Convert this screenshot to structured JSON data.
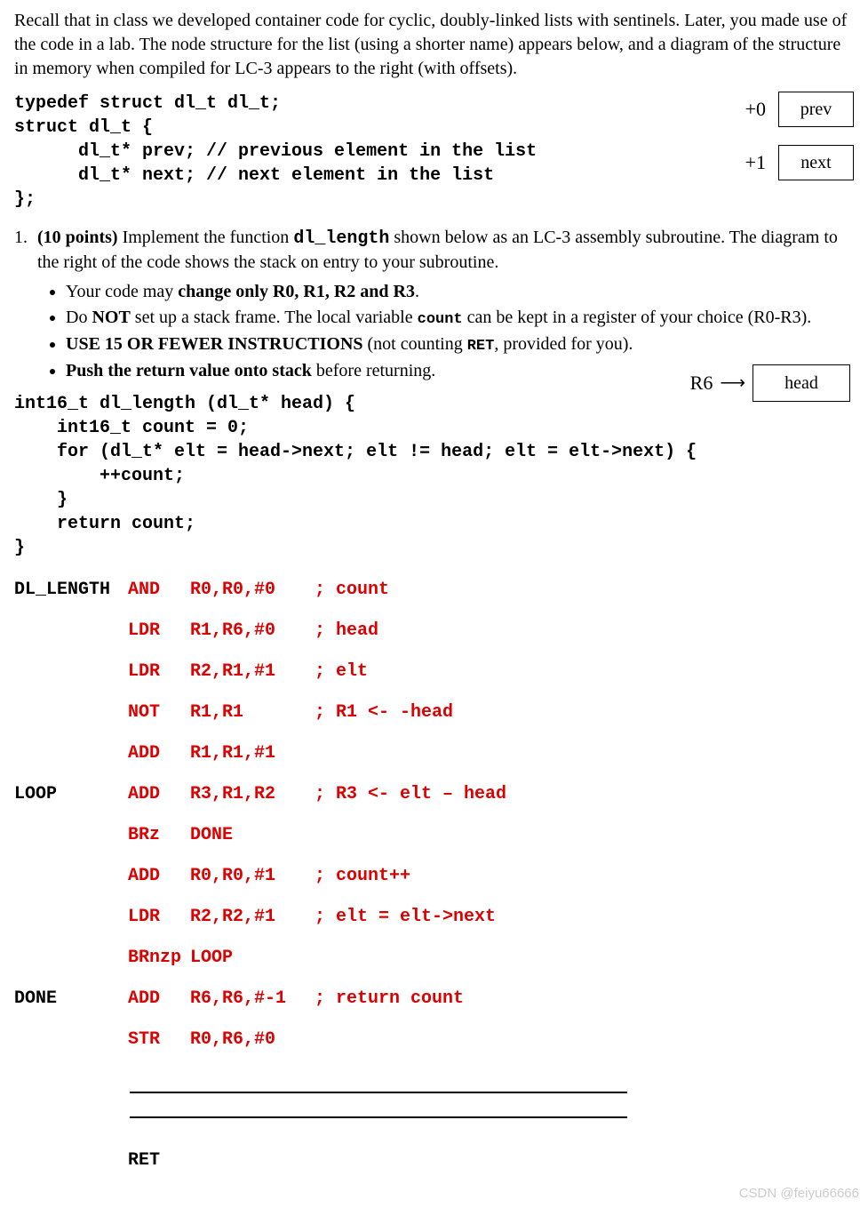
{
  "intro": "Recall that in class we developed container code for cyclic, doubly-linked lists with sentinels.  Later, you made use of the code in a lab.  The node structure for the list (using a shorter name) appears below, and a diagram of the structure in memory when compiled for LC-3 appears to the right (with offsets).",
  "typedef": "typedef struct dl_t dl_t;\nstruct dl_t {\n      dl_t* prev; // previous element in the list\n      dl_t* next; // next element in the list\n};",
  "mem": [
    {
      "offset": "+0",
      "field": "prev"
    },
    {
      "offset": "+1",
      "field": "next"
    }
  ],
  "question": {
    "num": "1.",
    "points": "(10 points)",
    "lead": " Implement the function ",
    "funcname": "dl_length",
    "after_func": " shown below as an LC-3 assembly subroutine. The diagram to the right of the code shows the stack on entry to your subroine.",
    "after_func_full": " shown below as an LC-3 assembly subroutine. The diagram to the right of the code shows the stack on entry to your subroutine."
  },
  "bullets": {
    "b1a": "Your code may ",
    "b1b": "change only R0, R1, R2 and R3",
    "b1c": ".",
    "b2a": "Do ",
    "b2b": "NOT",
    "b2c": " set up a stack frame.  The local variable ",
    "b2d": "count",
    "b2e": " can be kept in a register of your choice (R0-R3).",
    "b3a": "USE 15 OR FEWER INSTRUCTIONS",
    "b3b": " (not counting ",
    "b3c": "RET",
    "b3d": ", provided for you).",
    "b4a": "Push the return value onto stack",
    "b4b": " before returning."
  },
  "stack": {
    "reg": "R6",
    "cell": "head"
  },
  "cfunc": "int16_t dl_length (dl_t* head) {\n    int16_t count = 0;\n    for (dl_t* elt = head->next; elt != head; elt = elt->next) {\n        ++count;\n    }\n    return count;\n}",
  "asm": [
    {
      "label": "DL_LENGTH",
      "op": "AND",
      "args": "R0,R0,#0",
      "cmt": "; count"
    },
    {
      "label": "",
      "op": "LDR",
      "args": "R1,R6,#0",
      "cmt": "; head"
    },
    {
      "label": "",
      "op": "LDR",
      "args": "R2,R1,#1",
      "cmt": "; elt"
    },
    {
      "label": "",
      "op": "NOT",
      "args": "R1,R1",
      "cmt": "; R1 <- -head"
    },
    {
      "label": "",
      "op": "ADD",
      "args": "R1,R1,#1",
      "cmt": ""
    },
    {
      "label": "LOOP",
      "op": "ADD",
      "args": "R3,R1,R2",
      "cmt": "; R3 <- elt – head"
    },
    {
      "label": "",
      "op": "BRz",
      "args": "DONE",
      "cmt": ""
    },
    {
      "label": "",
      "op": "ADD",
      "args": "R0,R0,#1",
      "cmt": "; count++"
    },
    {
      "label": "",
      "op": "LDR",
      "args": "R2,R2,#1",
      "cmt": "; elt = elt->next"
    },
    {
      "label": "",
      "op": "BRnzp",
      "args": "LOOP",
      "cmt": ""
    },
    {
      "label": "DONE",
      "op": "ADD",
      "args": "R6,R6,#-1",
      "cmt": "; return count"
    },
    {
      "label": "",
      "op": "STR",
      "args": "R0,R6,#0",
      "cmt": ""
    }
  ],
  "ret": "RET",
  "watermark": "CSDN @feiyu66666"
}
